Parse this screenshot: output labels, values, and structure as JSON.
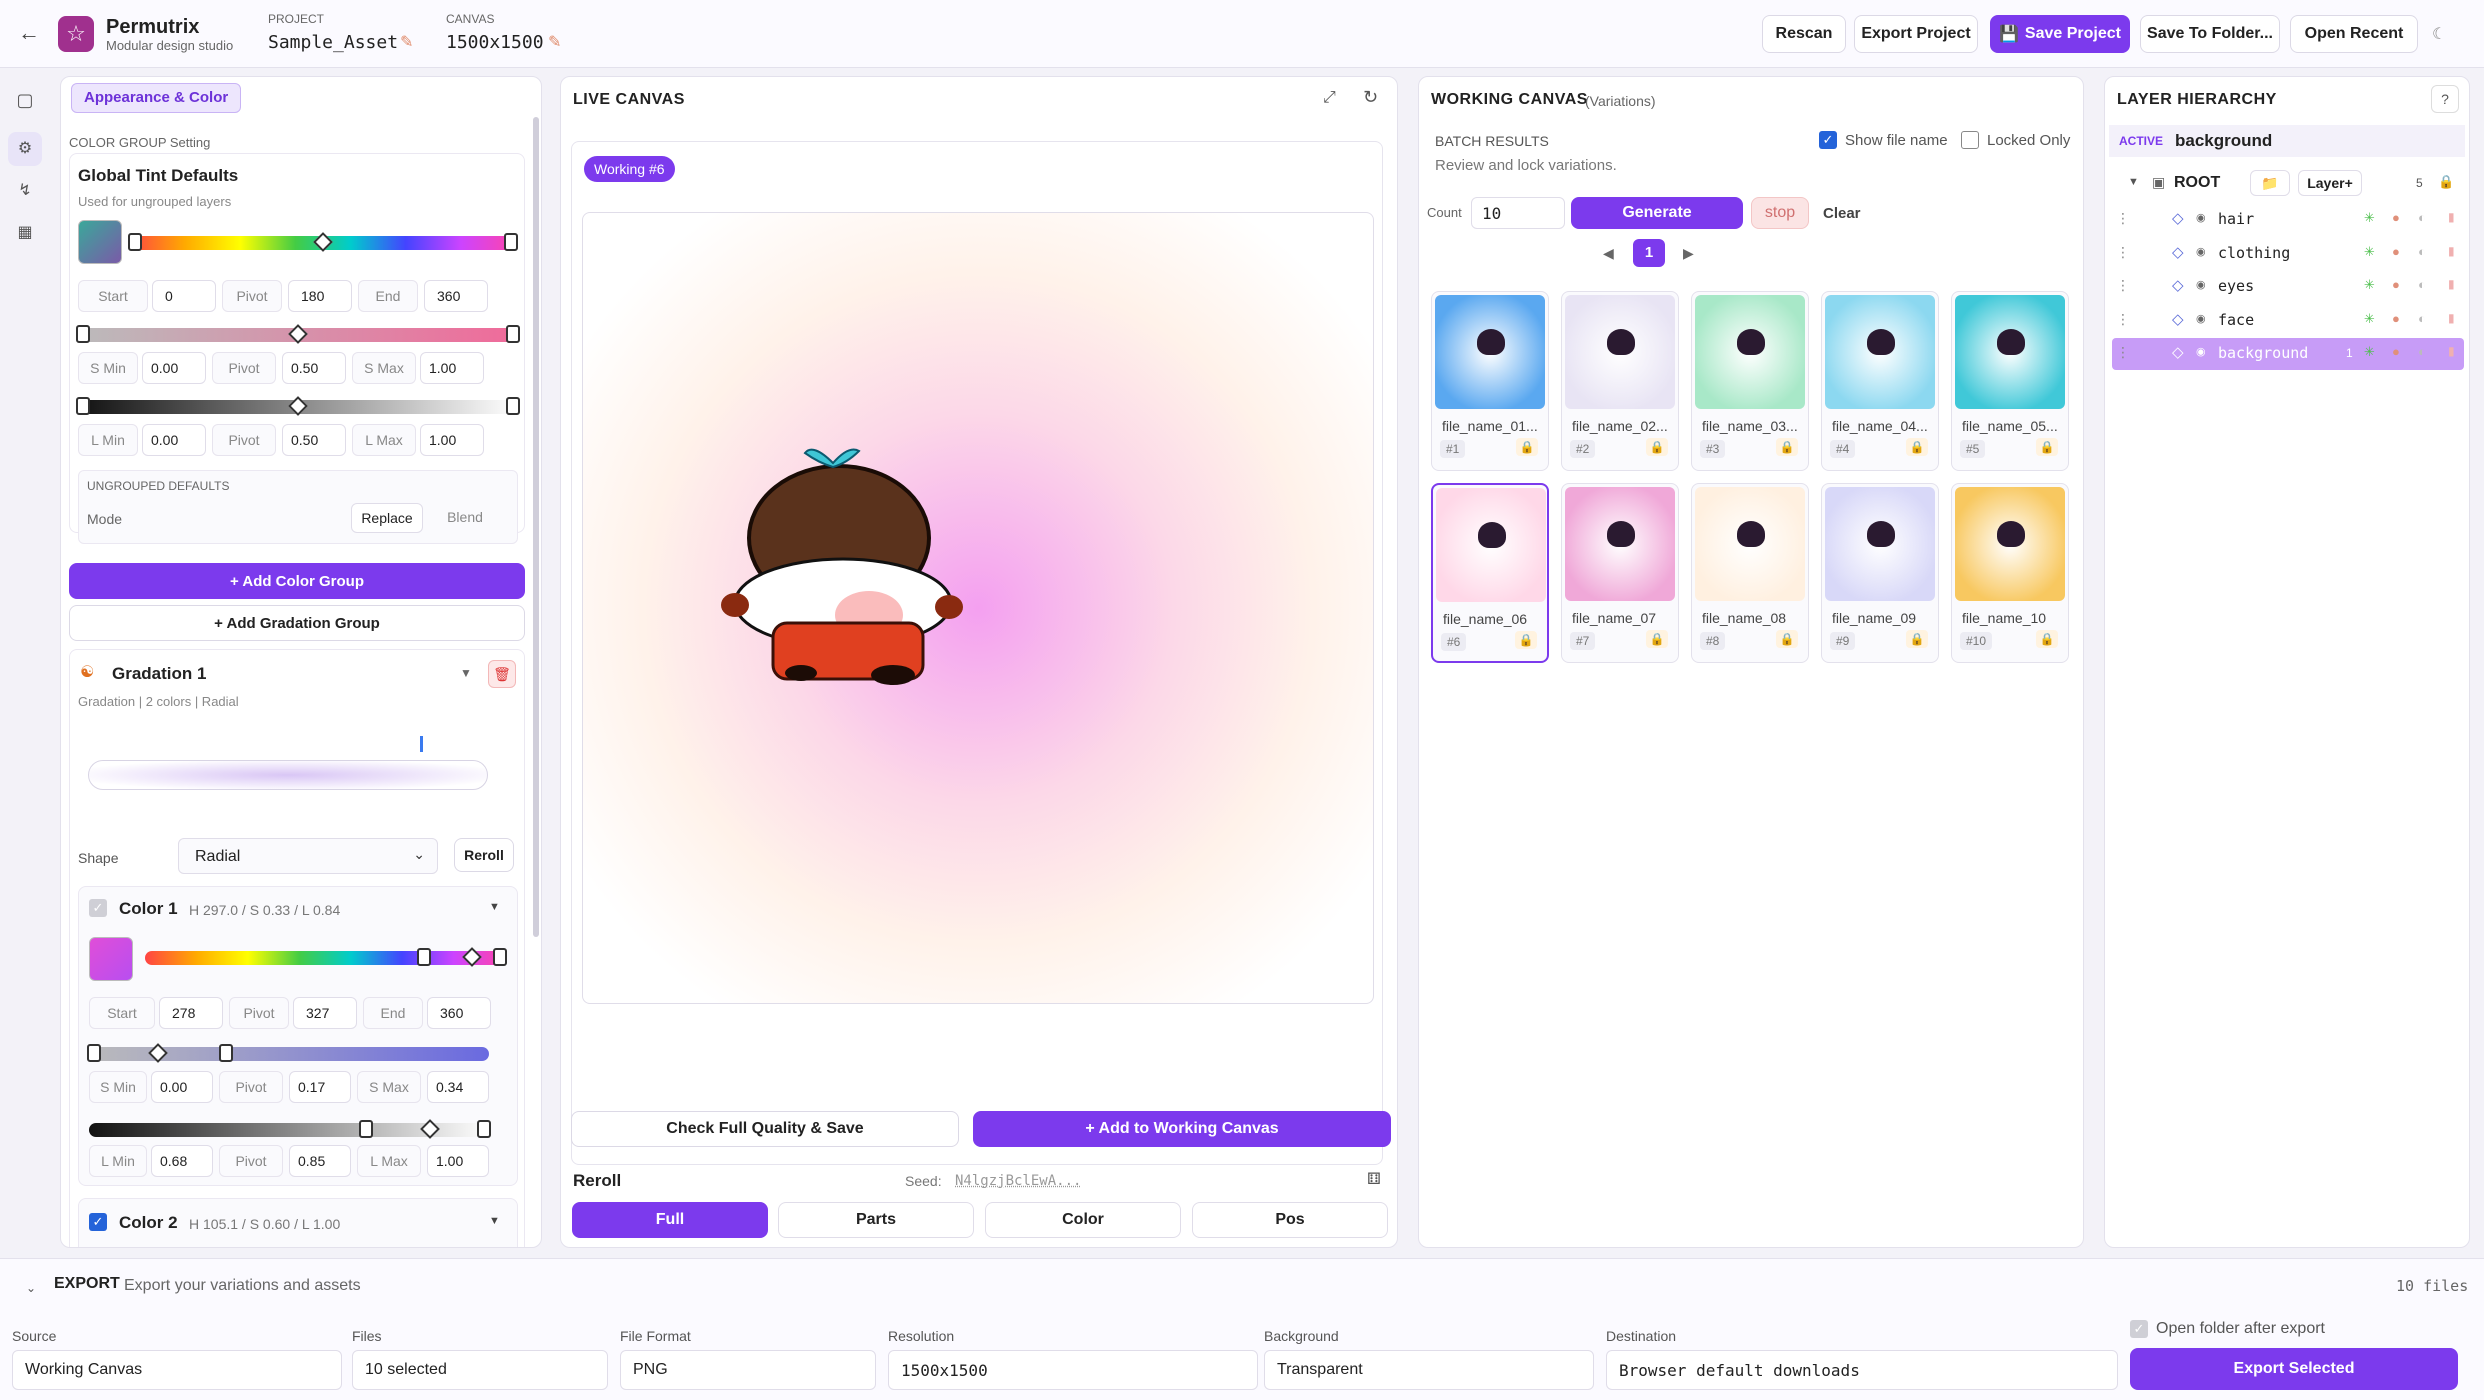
{
  "app": {
    "name": "Permutrix",
    "subtitle": "Modular design studio"
  },
  "header": {
    "project_label": "PROJECT",
    "project_name": "Sample_Asset",
    "canvas_label": "CANVAS",
    "canvas_size": "1500x1500",
    "buttons": {
      "rescan": "Rescan",
      "export_project": "Export Project",
      "save_project": "Save Project",
      "save_folder": "Save To Folder...",
      "open_recent": "Open Recent"
    }
  },
  "left": {
    "tab": "Appearance & Color",
    "section": "COLOR GROUP Setting",
    "global_title": "Global Tint Defaults",
    "global_sub": "Used for ungrouped layers",
    "hue": {
      "start_l": "Start",
      "start": "0",
      "pivot_l": "Pivot",
      "pivot": "180",
      "end_l": "End",
      "end": "360"
    },
    "sat": {
      "min_l": "S Min",
      "min": "0.00",
      "pivot_l": "Pivot",
      "pivot": "0.50",
      "max_l": "S Max",
      "max": "1.00"
    },
    "light": {
      "min_l": "L Min",
      "min": "0.00",
      "pivot_l": "Pivot",
      "pivot": "0.50",
      "max_l": "L Max",
      "max": "1.00"
    },
    "ungrouped": {
      "title": "UNGROUPED DEFAULTS",
      "mode": "Mode",
      "replace": "Replace",
      "blend": "Blend"
    },
    "add_color_group": "+ Add Color Group",
    "add_gradation_group": "+ Add Gradation Group",
    "gradation": {
      "title": "Gradation 1",
      "sub": "Gradation | 2 colors | Radial",
      "shape_l": "Shape",
      "shape": "Radial",
      "reroll": "Reroll"
    },
    "color1": {
      "title": "Color 1",
      "hsl": "H 297.0 / S 0.33 / L 0.84",
      "start_l": "Start",
      "start": "278",
      "pivot_l": "Pivot",
      "pivot": "327",
      "end_l": "End",
      "end": "360",
      "smin_l": "S Min",
      "smin": "0.00",
      "spivot_l": "Pivot",
      "spivot": "0.17",
      "smax_l": "S Max",
      "smax": "0.34",
      "lmin_l": "L Min",
      "lmin": "0.68",
      "lpivot_l": "Pivot",
      "lpivot": "0.85",
      "lmax_l": "L Max",
      "lmax": "1.00"
    },
    "color2": {
      "title": "Color 2",
      "hsl": "H 105.1 / S 0.60 / L 1.00"
    }
  },
  "live": {
    "title": "LIVE CANVAS",
    "badge": "Working #6",
    "check_btn": "Check Full Quality & Save",
    "add_btn": "+ Add to Working Canvas",
    "reroll": "Reroll",
    "seed_l": "Seed:",
    "seed": "N4lgzjBclEwA...",
    "tabs": [
      "Full",
      "Parts",
      "Color",
      "Pos"
    ]
  },
  "working": {
    "title": "WORKING CANVAS",
    "sub": "(Variations)",
    "batch": "BATCH RESULTS",
    "batch_sub": "Review and lock variations.",
    "show_file": "Show file name",
    "locked_only": "Locked Only",
    "count_l": "Count",
    "count": "10",
    "generate": "Generate",
    "stop": "stop",
    "clear": "Clear",
    "page": "1",
    "items": [
      {
        "name": "file_name_01....",
        "num": "#1",
        "bg": "#5aa8f0"
      },
      {
        "name": "file_name_02....",
        "num": "#2",
        "bg": "#e8e4f4"
      },
      {
        "name": "file_name_03....",
        "num": "#3",
        "bg": "#a8e8c8"
      },
      {
        "name": "file_name_04....",
        "num": "#4",
        "bg": "#8cd8f0"
      },
      {
        "name": "file_name_05....",
        "num": "#5",
        "bg": "#40c8d8"
      },
      {
        "name": "file_name_06",
        "num": "#6",
        "bg": "#ffd8e8"
      },
      {
        "name": "file_name_07",
        "num": "#7",
        "bg": "#f0a8d8"
      },
      {
        "name": "file_name_08",
        "num": "#8",
        "bg": "#fff0e0"
      },
      {
        "name": "file_name_09",
        "num": "#9",
        "bg": "#d8d8f8"
      },
      {
        "name": "file_name_10",
        "num": "#10",
        "bg": "#f8c860"
      }
    ]
  },
  "layers": {
    "title": "LAYER HIERARCHY",
    "help": "?",
    "active_l": "ACTIVE",
    "active": "background",
    "root": "ROOT",
    "layer_btn": "Layer+",
    "count": "5",
    "items": [
      {
        "name": "hair"
      },
      {
        "name": "clothing"
      },
      {
        "name": "eyes"
      },
      {
        "name": "face"
      },
      {
        "name": "background",
        "badge": "1"
      }
    ]
  },
  "export": {
    "title": "EXPORT",
    "sub": "Export your variations and assets",
    "files_count": "10 files",
    "source_l": "Source",
    "source": "Working Canvas",
    "files_l": "Files",
    "files": "10 selected",
    "format_l": "File Format",
    "format": "PNG",
    "res_l": "Resolution",
    "res": "1500x1500",
    "bg_l": "Background",
    "bg": "Transparent",
    "dest_l": "Destination",
    "dest": "Browser default downloads",
    "open_folder": "Open folder after export",
    "export_btn": "Export Selected"
  }
}
